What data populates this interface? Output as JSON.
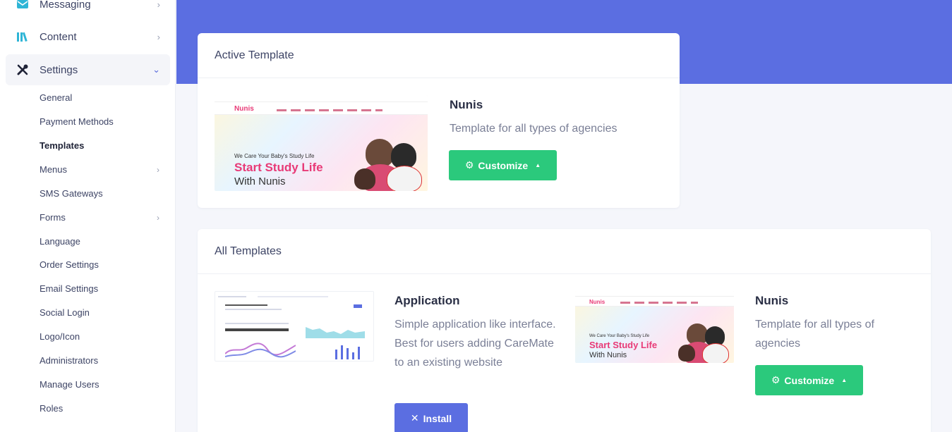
{
  "sidebar": {
    "nav": [
      {
        "label": "Messaging",
        "icon": "envelope-icon"
      },
      {
        "label": "Content",
        "icon": "books-icon"
      },
      {
        "label": "Settings",
        "icon": "tools-icon"
      }
    ],
    "sub_items": [
      {
        "label": "General"
      },
      {
        "label": "Payment Methods"
      },
      {
        "label": "Templates"
      },
      {
        "label": "Menus"
      },
      {
        "label": "SMS Gateways"
      },
      {
        "label": "Forms"
      },
      {
        "label": "Language"
      },
      {
        "label": "Order Settings"
      },
      {
        "label": "Email Settings"
      },
      {
        "label": "Social Login"
      },
      {
        "label": "Logo/Icon"
      },
      {
        "label": "Administrators"
      },
      {
        "label": "Manage Users"
      },
      {
        "label": "Roles"
      }
    ]
  },
  "active_template": {
    "header": "Active Template",
    "name": "Nunis",
    "description": "Template for all types of agencies",
    "button_label": "Customize",
    "preview": {
      "logo": "Nunis",
      "tagline": "We Care Your Baby's Study Life",
      "headline": "Start Study Life",
      "subline": "With Nunis"
    }
  },
  "all_templates": {
    "header": "All Templates",
    "items": [
      {
        "name": "Application",
        "description": "Simple application like interface. Best for users adding CareMate to an existing website",
        "button_label": "Install"
      },
      {
        "name": "Nunis",
        "description": "Template for all types of agencies",
        "button_label": "Customize",
        "preview": {
          "logo": "Nunis",
          "tagline": "We Care Your Baby's Study Life",
          "headline": "Start Study Life",
          "subline": "With Nunis"
        }
      }
    ]
  },
  "colors": {
    "accent": "#5b6ee1",
    "success": "#2bc97c"
  }
}
